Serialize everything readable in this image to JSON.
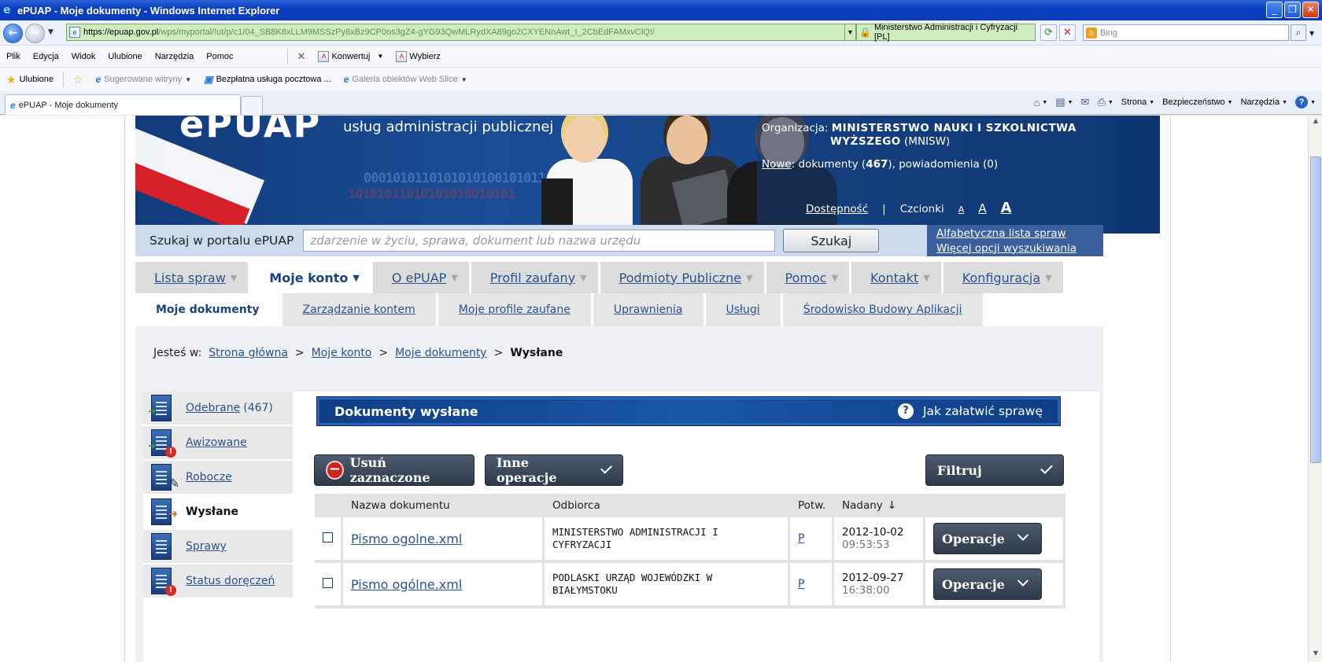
{
  "window": {
    "title": "ePUAP - Moje dokumenty - Windows Internet Explorer",
    "minimize": "_",
    "maximize": "❐",
    "close": "✕"
  },
  "address": {
    "url_main": "https://epuap.gov.pl",
    "url_rest": "/wps/myportal/!ut/p/c1/04_SB8K8xLLM9MSSzPy8xBz9CP0os3gZ4-gYG93QwMLRydXA89go2CXYENnAwt_I_2CbEdFAMxvClQ!/",
    "certificate": "Ministerstwo Administracji i Cyfryzacji [PL]",
    "search_placeholder": "Bing"
  },
  "menubar": {
    "items": [
      "Plik",
      "Edycja",
      "Widok",
      "Ulubione",
      "Narzędzia",
      "Pomoc"
    ],
    "tool_convert": "Konwertuj",
    "tool_select": "Wybierz"
  },
  "favorites": {
    "label": "Ulubione",
    "items": [
      "Sugerowane witryny",
      "Bezpłatna usługa pocztowa ...",
      "Galeria obiektów Web Slice"
    ]
  },
  "tabs": {
    "active": "ePUAP - Moje dokumenty"
  },
  "commandbar": {
    "page": "Strona",
    "security": "Bezpieczeństwo",
    "tools": "Narzędzia"
  },
  "banner": {
    "logo": "ePUAP",
    "tagline": "usług administracji publicznej",
    "binary1": "0001010110101010100101011",
    "binary2": "10101011010101010010101",
    "org_label": "Organizacja:",
    "org_name_1": "MINISTERSTWO NAUKI I SZKOLNICTWA",
    "org_name_2": "WYŻSZEGO",
    "org_abbr": "(MNISW)",
    "new_link": "Nowe",
    "docs_text": ": dokumenty (",
    "docs_count": "467",
    "notif_text": "), powiadomienia (0)",
    "accessibility": "Dostępność",
    "sep": "|",
    "fonts_label": "Czcionki",
    "font_a": "A"
  },
  "search": {
    "label": "Szukaj w portalu ePUAP",
    "placeholder": "zdarzenie w życiu, sprawa, dokument lub nazwa urzędu",
    "button": "Szukaj",
    "link_alpha": "Alfabetyczna lista spraw",
    "link_more": "Więcej opcji wyszukiwania"
  },
  "mainnav": [
    {
      "label": "Lista spraw"
    },
    {
      "label": "Moje konto"
    },
    {
      "label": "O ePUAP"
    },
    {
      "label": "Profil zaufany"
    },
    {
      "label": "Podmioty Publiczne"
    },
    {
      "label": "Pomoc"
    },
    {
      "label": "Kontakt"
    },
    {
      "label": "Konfiguracja"
    }
  ],
  "subnav": [
    {
      "label": "Moje dokumenty"
    },
    {
      "label": "Zarządzanie kontem"
    },
    {
      "label": "Moje profile zaufane"
    },
    {
      "label": "Uprawnienia"
    },
    {
      "label": "Usługi"
    },
    {
      "label": "Środowisko Budowy Aplikacji"
    }
  ],
  "breadcrumb": {
    "prefix": "Jesteś w:",
    "items": [
      "Strona główna",
      "Moje konto",
      "Moje dokumenty"
    ],
    "sep": ">",
    "current": "Wysłane"
  },
  "leftmenu": [
    {
      "label": "Odebrane",
      "count": "(467)"
    },
    {
      "label": "Awizowane"
    },
    {
      "label": "Robocze"
    },
    {
      "label": "Wysłane"
    },
    {
      "label": "Sprawy"
    },
    {
      "label": "Status doręczeń"
    }
  ],
  "panel": {
    "title": "Dokumenty wysłane",
    "help": "Jak załatwić sprawę",
    "btn_delete": "Usuń zaznaczone",
    "btn_other": "Inne operacje",
    "btn_filter": "Filtruj"
  },
  "table": {
    "headers": [
      "Nazwa dokumentu",
      "Odbiorca",
      "Potw.",
      "Nadany"
    ],
    "rows": [
      {
        "name": "Pismo ogolne.xml",
        "recipient_1": "MINISTERSTWO ADMINISTRACJI I",
        "recipient_2": "CYFRYZACJI",
        "confirm": "P",
        "date": "2012-10-02",
        "time": "09:53:53",
        "op": "Operacje"
      },
      {
        "name": "Pismo ogólne.xml",
        "recipient_1": "PODLASKI URZĄD WOJEWÓDZKI W",
        "recipient_2": "BIAŁYMSTOKU",
        "confirm": "P",
        "date": "2012-09-27",
        "time": "16:38:00",
        "op": "Operacje"
      }
    ]
  },
  "colors": {
    "link": "#2b5391",
    "banner": "#1a4d96",
    "header": "#1a56a8",
    "button": "#3a4656"
  }
}
